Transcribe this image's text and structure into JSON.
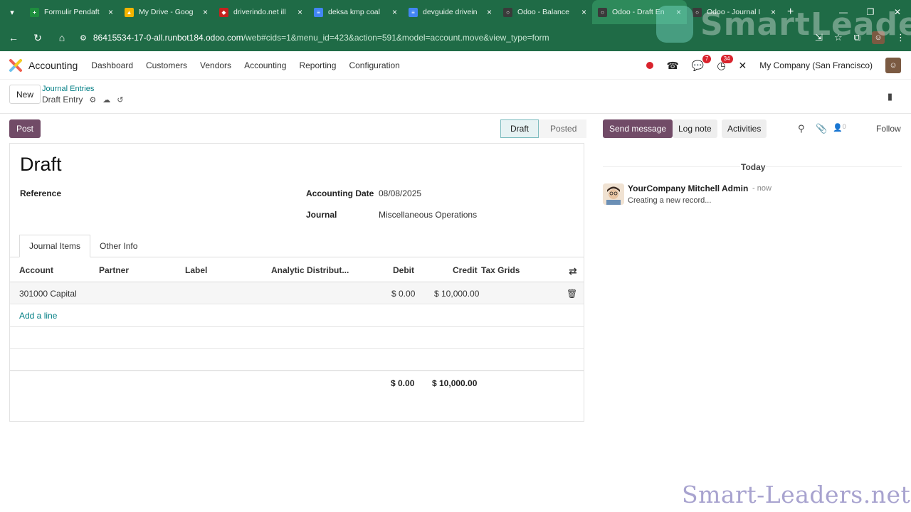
{
  "browser": {
    "tabs": [
      {
        "title": "Formulir Pendaft",
        "color": "#1e8e3e",
        "glyph": "+"
      },
      {
        "title": "My Drive - Goog",
        "color": "#f4b400",
        "glyph": "▲"
      },
      {
        "title": "driverindo.net ill",
        "color": "#c5221f",
        "glyph": "◆"
      },
      {
        "title": "deksa kmp coal",
        "color": "#4285f4",
        "glyph": "≡"
      },
      {
        "title": "devguide drivein",
        "color": "#4285f4",
        "glyph": "≡"
      },
      {
        "title": "Odoo - Balance",
        "color": "#3a3a3a",
        "glyph": "○"
      },
      {
        "title": "Odoo - Draft En",
        "color": "#3a3a3a",
        "glyph": "○"
      },
      {
        "title": "Odoo - Journal I",
        "color": "#3a3a3a",
        "glyph": "○"
      }
    ],
    "url_host": "86415534-17-0-all.runbot184.odoo.com",
    "url_path": "/web#cids=1&menu_id=423&action=591&model=account.move&view_type=form"
  },
  "watermark": {
    "logo": "SmartLeaders",
    "site": "Smart-Leaders.net"
  },
  "navbar": {
    "app_name": "Accounting",
    "menu": [
      "Dashboard",
      "Customers",
      "Vendors",
      "Accounting",
      "Reporting",
      "Configuration"
    ],
    "messages_count": "7",
    "activities_count": "34",
    "company": "My Company (San Francisco)"
  },
  "control_panel": {
    "new_label": "New",
    "breadcrumb_parent": "Journal Entries",
    "breadcrumb_current": "Draft Entry"
  },
  "status": {
    "post_label": "Post",
    "stages": [
      "Draft",
      "Posted"
    ],
    "current": "Draft"
  },
  "form": {
    "title": "Draft",
    "reference_label": "Reference",
    "accounting_date_label": "Accounting Date",
    "accounting_date": "08/08/2025",
    "journal_label": "Journal",
    "journal": "Miscellaneous Operations",
    "tabs": [
      "Journal Items",
      "Other Info"
    ],
    "columns": [
      "Account",
      "Partner",
      "Label",
      "Analytic Distribut...",
      "Debit",
      "Credit",
      "Tax Grids"
    ],
    "lines": [
      {
        "account": "301000 Capital",
        "partner": "",
        "label": "",
        "analytic": "",
        "debit": "$ 0.00",
        "credit": "$ 10,000.00",
        "tax_grids": ""
      }
    ],
    "add_line": "Add a line",
    "total_debit": "$ 0.00",
    "total_credit": "$ 10,000.00"
  },
  "chatter": {
    "send_message": "Send message",
    "log_note": "Log note",
    "activities": "Activities",
    "followers_count": "0",
    "follow": "Follow",
    "date_separator": "Today",
    "messages": [
      {
        "author": "YourCompany Mitchell Admin",
        "time": "- now",
        "body": "Creating a new record..."
      }
    ]
  },
  "colors": {
    "primary": "#714b67",
    "link": "#017e84",
    "chrome": "#1f6b46"
  }
}
